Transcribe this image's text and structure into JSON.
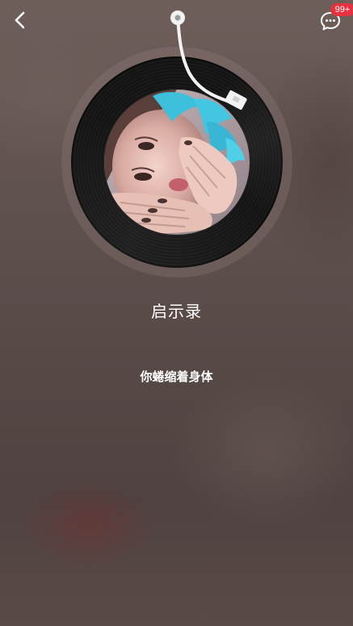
{
  "header": {
    "back_icon": "chevron-left-icon",
    "messages_icon": "chat-bubble-icon",
    "messages_badge": "99+"
  },
  "player": {
    "song_title": "启示录",
    "current_lyric": "你蜷缩着身体"
  },
  "colors": {
    "badge": "#e8313f",
    "tonearm": "#f2f2f2",
    "record": "#141414",
    "text": "#ffffff"
  }
}
